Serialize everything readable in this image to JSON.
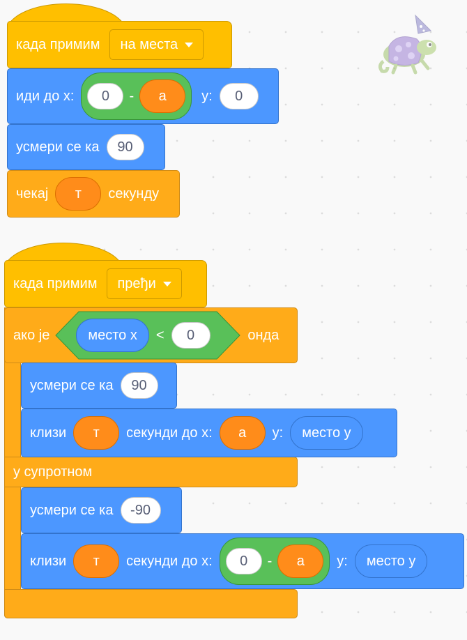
{
  "script1": {
    "hat": {
      "label": "када примим",
      "message": "на места"
    },
    "goto": {
      "label": "иди до x:",
      "x_value": "0",
      "minus": "-",
      "x_var": "a",
      "y_label": "y:",
      "y_value": "0"
    },
    "point": {
      "label": "усмери се ка",
      "value": "90"
    },
    "wait": {
      "label": "чекај",
      "var": "т",
      "suffix": "секунду"
    }
  },
  "script2": {
    "hat": {
      "label": "када примим",
      "message": "пређи"
    },
    "if": {
      "label": "ако је",
      "cond_reporter": "место x",
      "cond_op": "<",
      "cond_value": "0",
      "then": "онда"
    },
    "point1": {
      "label": "усмери се ка",
      "value": "90"
    },
    "glide1": {
      "label": "клизи",
      "var": "т",
      "middle": "секунди до x:",
      "x_var": "a",
      "y_label": "y:",
      "y_reporter": "место y"
    },
    "else": {
      "label": "у супротном"
    },
    "point2": {
      "label": "усмери се ка",
      "value": "-90"
    },
    "glide2": {
      "label": "клизи",
      "var": "т",
      "middle": "секунди до x:",
      "x_value": "0",
      "minus": "-",
      "x_var": "a",
      "y_label": "y:",
      "y_reporter": "место y"
    }
  },
  "sprite": {
    "icon": "chameleon-wizard-sprite-icon"
  },
  "colors": {
    "events": "#ffbf00",
    "control": "#ffab19",
    "motion": "#4c97ff",
    "operators": "#59c059",
    "variables": "#ff8c1a"
  }
}
